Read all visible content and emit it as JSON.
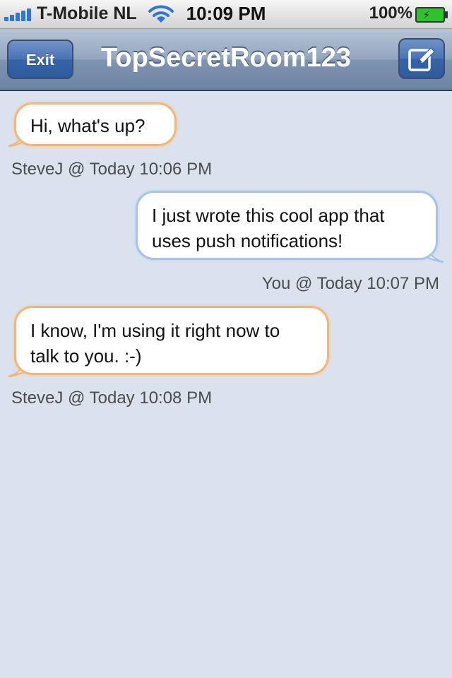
{
  "status_bar": {
    "carrier": "T-Mobile NL",
    "time": "10:09 PM",
    "battery": "100%",
    "signal_icon": "signal-bars-icon",
    "wifi_icon": "wifi-icon",
    "battery_icon": "battery-charging-icon"
  },
  "nav": {
    "exit_label": "Exit",
    "title": "TopSecretRoom123",
    "compose_icon": "compose-icon"
  },
  "messages": [
    {
      "direction": "incoming",
      "lines": [
        "Hi, what's up?"
      ],
      "meta": "SteveJ @ Today 10:06 PM"
    },
    {
      "direction": "outgoing",
      "lines": [
        "I just wrote this cool app that",
        "uses push notifications!"
      ],
      "meta": "You @ Today 10:07 PM"
    },
    {
      "direction": "incoming",
      "lines": [
        "I know, I'm using it right now to",
        "talk to you. :-)"
      ],
      "meta": "SteveJ @ Today 10:08 PM"
    }
  ],
  "colors": {
    "background": "#dbe2ed",
    "incoming_border": "#f1b679",
    "outgoing_border": "#a9c2ec",
    "nav_button": "#3763a8"
  }
}
